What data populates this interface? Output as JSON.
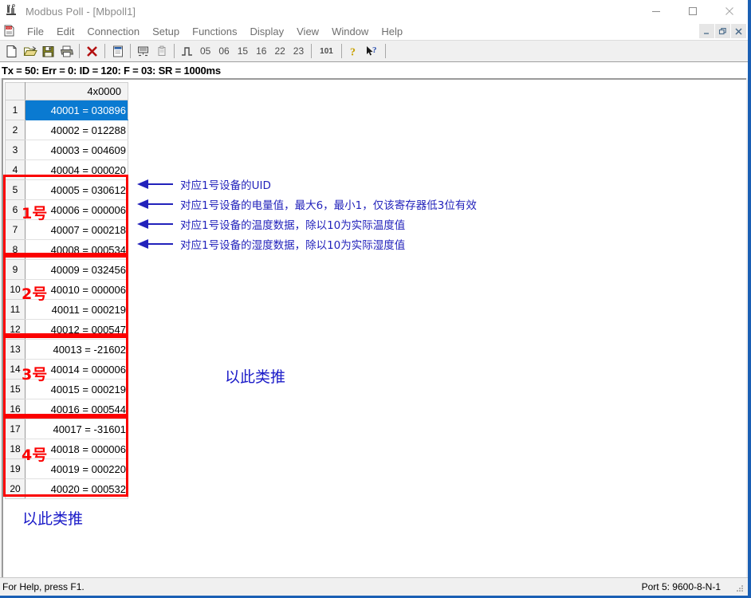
{
  "window": {
    "title": "Modbus Poll - [Mbpoll1]",
    "app_icon": "modbus-poll-icon",
    "controls": {
      "minimize": "minimize-icon",
      "maximize": "maximize-icon",
      "close": "close-icon"
    }
  },
  "mdi": {
    "doc_icon": "document-icon",
    "controls": {
      "minimize": "mdi-minimize-icon",
      "restore": "mdi-restore-icon",
      "close": "mdi-close-icon"
    }
  },
  "menu": {
    "items": [
      {
        "label": "File"
      },
      {
        "label": "Edit"
      },
      {
        "label": "Connection"
      },
      {
        "label": "Setup"
      },
      {
        "label": "Functions"
      },
      {
        "label": "Display"
      },
      {
        "label": "View"
      },
      {
        "label": "Window"
      },
      {
        "label": "Help"
      }
    ]
  },
  "toolbar": {
    "buttons": [
      {
        "name": "new-file-icon",
        "type": "icon"
      },
      {
        "name": "open-file-icon",
        "type": "icon"
      },
      {
        "name": "save-file-icon",
        "type": "icon"
      },
      {
        "name": "print-icon",
        "type": "icon"
      },
      {
        "name": "separator",
        "type": "sep"
      },
      {
        "name": "disconnect-icon",
        "type": "icon"
      },
      {
        "name": "separator",
        "type": "sep"
      },
      {
        "name": "read-write-definition-icon",
        "type": "icon"
      },
      {
        "name": "separator",
        "type": "sep"
      },
      {
        "name": "poll-definition-icon",
        "type": "icon"
      },
      {
        "name": "copy-icon",
        "type": "icon"
      },
      {
        "name": "separator",
        "type": "sep"
      },
      {
        "name": "function-01-icon",
        "type": "icon"
      }
    ],
    "function_codes": [
      "05",
      "06",
      "15",
      "16",
      "22",
      "23"
    ],
    "decimal_label": "101",
    "help_icon": "help-question-icon",
    "context_help_icon": "context-help-icon"
  },
  "poll_status": "Tx = 50: Err = 0: ID = 120: F = 03: SR = 1000ms",
  "grid": {
    "column_header": "4x0000",
    "rows": [
      {
        "index": "1",
        "value": "40001 = 030896",
        "selected": true
      },
      {
        "index": "2",
        "value": "40002 = 012288",
        "selected": false
      },
      {
        "index": "3",
        "value": "40003 = 004609",
        "selected": false
      },
      {
        "index": "4",
        "value": "40004 = 000020",
        "selected": false
      },
      {
        "index": "5",
        "value": "40005 = 030612",
        "selected": false
      },
      {
        "index": "6",
        "value": "40006 = 000006",
        "selected": false
      },
      {
        "index": "7",
        "value": "40007 = 000218",
        "selected": false
      },
      {
        "index": "8",
        "value": "40008 = 000534",
        "selected": false
      },
      {
        "index": "9",
        "value": "40009 = 032456",
        "selected": false
      },
      {
        "index": "10",
        "value": "40010 = 000006",
        "selected": false
      },
      {
        "index": "11",
        "value": "40011 = 000219",
        "selected": false
      },
      {
        "index": "12",
        "value": "40012 = 000547",
        "selected": false
      },
      {
        "index": "13",
        "value": "40013 = -21602",
        "selected": false
      },
      {
        "index": "14",
        "value": "40014 = 000006",
        "selected": false
      },
      {
        "index": "15",
        "value": "40015 = 000219",
        "selected": false
      },
      {
        "index": "16",
        "value": "40016 = 000544",
        "selected": false
      },
      {
        "index": "17",
        "value": "40017 = -31601",
        "selected": false
      },
      {
        "index": "18",
        "value": "40018 = 000006",
        "selected": false
      },
      {
        "index": "19",
        "value": "40019 = 000220",
        "selected": false
      },
      {
        "index": "20",
        "value": "40020 = 000532",
        "selected": false
      }
    ]
  },
  "groups": [
    {
      "label": "1号"
    },
    {
      "label": "2号"
    },
    {
      "label": "3号"
    },
    {
      "label": "4号"
    }
  ],
  "annotations": [
    {
      "icon": "left-arrow-icon",
      "text": "对应1号设备的UID"
    },
    {
      "icon": "left-arrow-icon",
      "text": "对应1号设备的电量值，最大6，最小1，仅该寄存器低3位有效"
    },
    {
      "icon": "left-arrow-icon",
      "text": "对应1号设备的温度数据，除以10为实际温度值"
    },
    {
      "icon": "left-arrow-icon",
      "text": "对应1号设备的湿度数据，除以10为实际湿度值"
    }
  ],
  "notes": {
    "center": "以此类推",
    "bottom": "以此类推"
  },
  "statusbar": {
    "help_hint": "For Help, press F1.",
    "port_info": "Port 5: 9600-8-N-1",
    "grip_icon": "resize-grip-icon"
  },
  "colors": {
    "selection_blue": "#0a7ad1",
    "annotation_blue": "#2222bb",
    "note_blue": "#1a1ac8",
    "group_red": "#fb0000",
    "window_border": "#1a5fb4"
  }
}
